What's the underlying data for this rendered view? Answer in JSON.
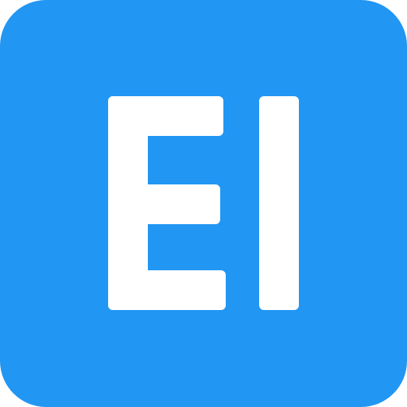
{
  "icon": {
    "letters": "EI",
    "background_color": "#2196f3",
    "foreground_color": "#ffffff"
  }
}
